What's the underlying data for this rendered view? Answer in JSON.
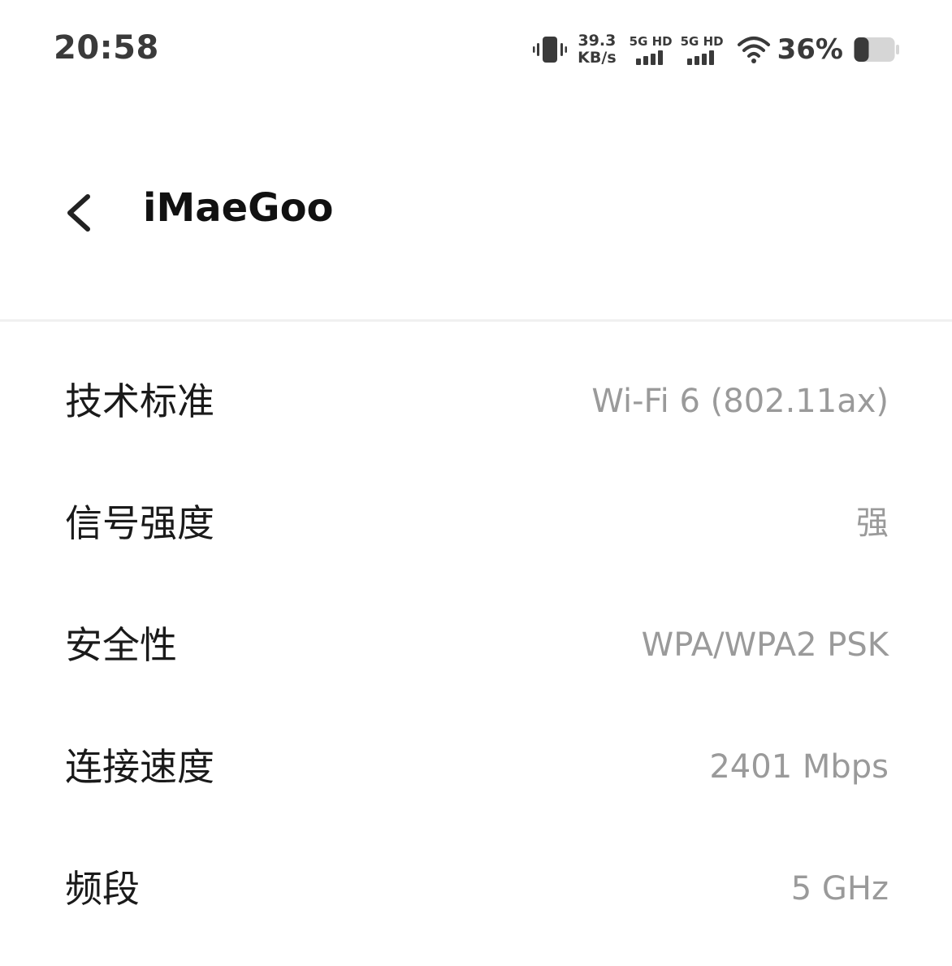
{
  "status_bar": {
    "time": "20:58",
    "net_speed_value": "39.3",
    "net_speed_unit": "KB/s",
    "sim1_tag": "5G HD",
    "sim2_tag": "5G HD",
    "battery_percent": "36%",
    "battery_level": 0.36,
    "icons": [
      "vibrate-icon",
      "signal-bars-icon",
      "signal-bars-icon",
      "wifi-icon",
      "battery-icon"
    ]
  },
  "header": {
    "back_icon": "chevron-left-icon",
    "title": "iMaeGoo"
  },
  "details": [
    {
      "label": "技术标准",
      "value": "Wi-Fi 6 (802.11ax)"
    },
    {
      "label": "信号强度",
      "value": "强"
    },
    {
      "label": "安全性",
      "value": "WPA/WPA2 PSK"
    },
    {
      "label": "连接速度",
      "value": "2401 Mbps"
    },
    {
      "label": "频段",
      "value": "5 GHz"
    }
  ],
  "colors": {
    "background": "#ffffff",
    "label_text": "#1a1a1a",
    "value_text": "#9a9a9a",
    "status_text": "#3a3a3a",
    "divider": "#f0f0f0"
  }
}
